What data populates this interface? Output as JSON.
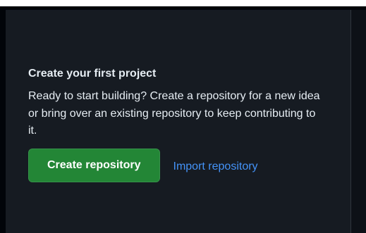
{
  "empty_state": {
    "title": "Create your first project",
    "description": "Ready to start building? Create a repository for a new idea or bring over an existing repository to keep contributing to it.",
    "create_button_label": "Create repository",
    "import_link_label": "Import repository"
  },
  "colors": {
    "page_background": "#010409",
    "panel_background": "#161b22",
    "primary_button": "#238636",
    "link": "#4493f8",
    "text": "#e6edf3"
  }
}
